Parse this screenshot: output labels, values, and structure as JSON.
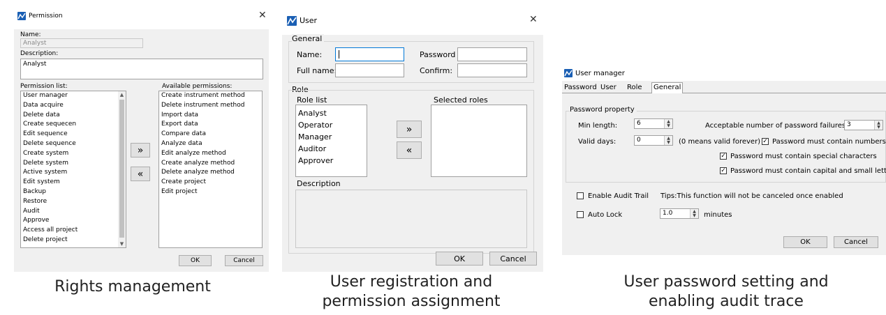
{
  "permission_window": {
    "title": "Permission",
    "name_label": "Name:",
    "name_value": "Analyst",
    "description_label": "Description:",
    "description_value": "Analyst",
    "permission_list_label": "Permission list:",
    "permission_list": [
      "User manager",
      "Data acquire",
      "Delete data",
      "Create sequecen",
      "Edit sequence",
      "Delete sequence",
      "Create system",
      "Delete system",
      "Active system",
      "Edit system",
      "Backup",
      "Restore",
      "Audit",
      "Approve",
      "Access all project",
      "Delete project"
    ],
    "available_label": "Available permissions:",
    "available_list": [
      "Create instrument method",
      "Delete instrument method",
      "Import data",
      "Export data",
      "Compare data",
      "Analyze data",
      "Edit analyze method",
      "Create analyze method",
      "Delete analyze method",
      "Create project",
      "Edit project"
    ],
    "add_button": "»",
    "remove_button": "«",
    "ok_label": "OK",
    "cancel_label": "Cancel"
  },
  "user_window": {
    "title": "User",
    "general_label": "General",
    "name_label": "Name:",
    "fullname_label": "Full name:",
    "password_label": "Password",
    "confirm_label": "Confirm:",
    "role_label": "Role",
    "role_list_label": "Role list",
    "roles": [
      "Analyst",
      "Operator",
      "Manager",
      "Auditor",
      "Approver"
    ],
    "selected_roles_label": "Selected roles",
    "add_button": "»",
    "remove_button": "«",
    "description_label": "Description",
    "ok_label": "OK",
    "cancel_label": "Cancel"
  },
  "user_manager_window": {
    "title": "User manager",
    "tabs": [
      {
        "label": "Password",
        "active": false
      },
      {
        "label": "User",
        "active": false
      },
      {
        "label": "Role",
        "active": false
      },
      {
        "label": "General",
        "active": true
      }
    ],
    "password_property_label": "Password property",
    "min_length_label": "Min length:",
    "min_length_value": "6",
    "failures_label": "Acceptable number of password failures:",
    "failures_value": "3",
    "valid_days_label": "Valid days:",
    "valid_days_value": "0",
    "valid_days_hint": "(0 means valid forever)",
    "chk_numbers": {
      "label": "Password must contain numbers",
      "checked": true
    },
    "chk_special": {
      "label": "Password must contain special characters",
      "checked": true
    },
    "chk_case": {
      "label": "Password must contain capital and small letters",
      "checked": true
    },
    "audit_trail": {
      "label": "Enable Audit Trail",
      "checked": false
    },
    "audit_tips": "Tips:This function will not be canceled once enabled",
    "auto_lock": {
      "label": "Auto Lock",
      "checked": false
    },
    "auto_lock_value": "1.0",
    "minutes_label": "minutes",
    "ok_label": "OK",
    "cancel_label": "Cancel"
  },
  "captions": {
    "left": "Rights management",
    "middle_line1": "User registration and",
    "middle_line2": "permission assignment",
    "right_line1": "User password setting and",
    "right_line2": "enabling audit trace"
  },
  "colors": {
    "app_icon": "#1a5fb4",
    "window_bg": "#f0f0f0",
    "active_field_border": "#0078d7"
  }
}
